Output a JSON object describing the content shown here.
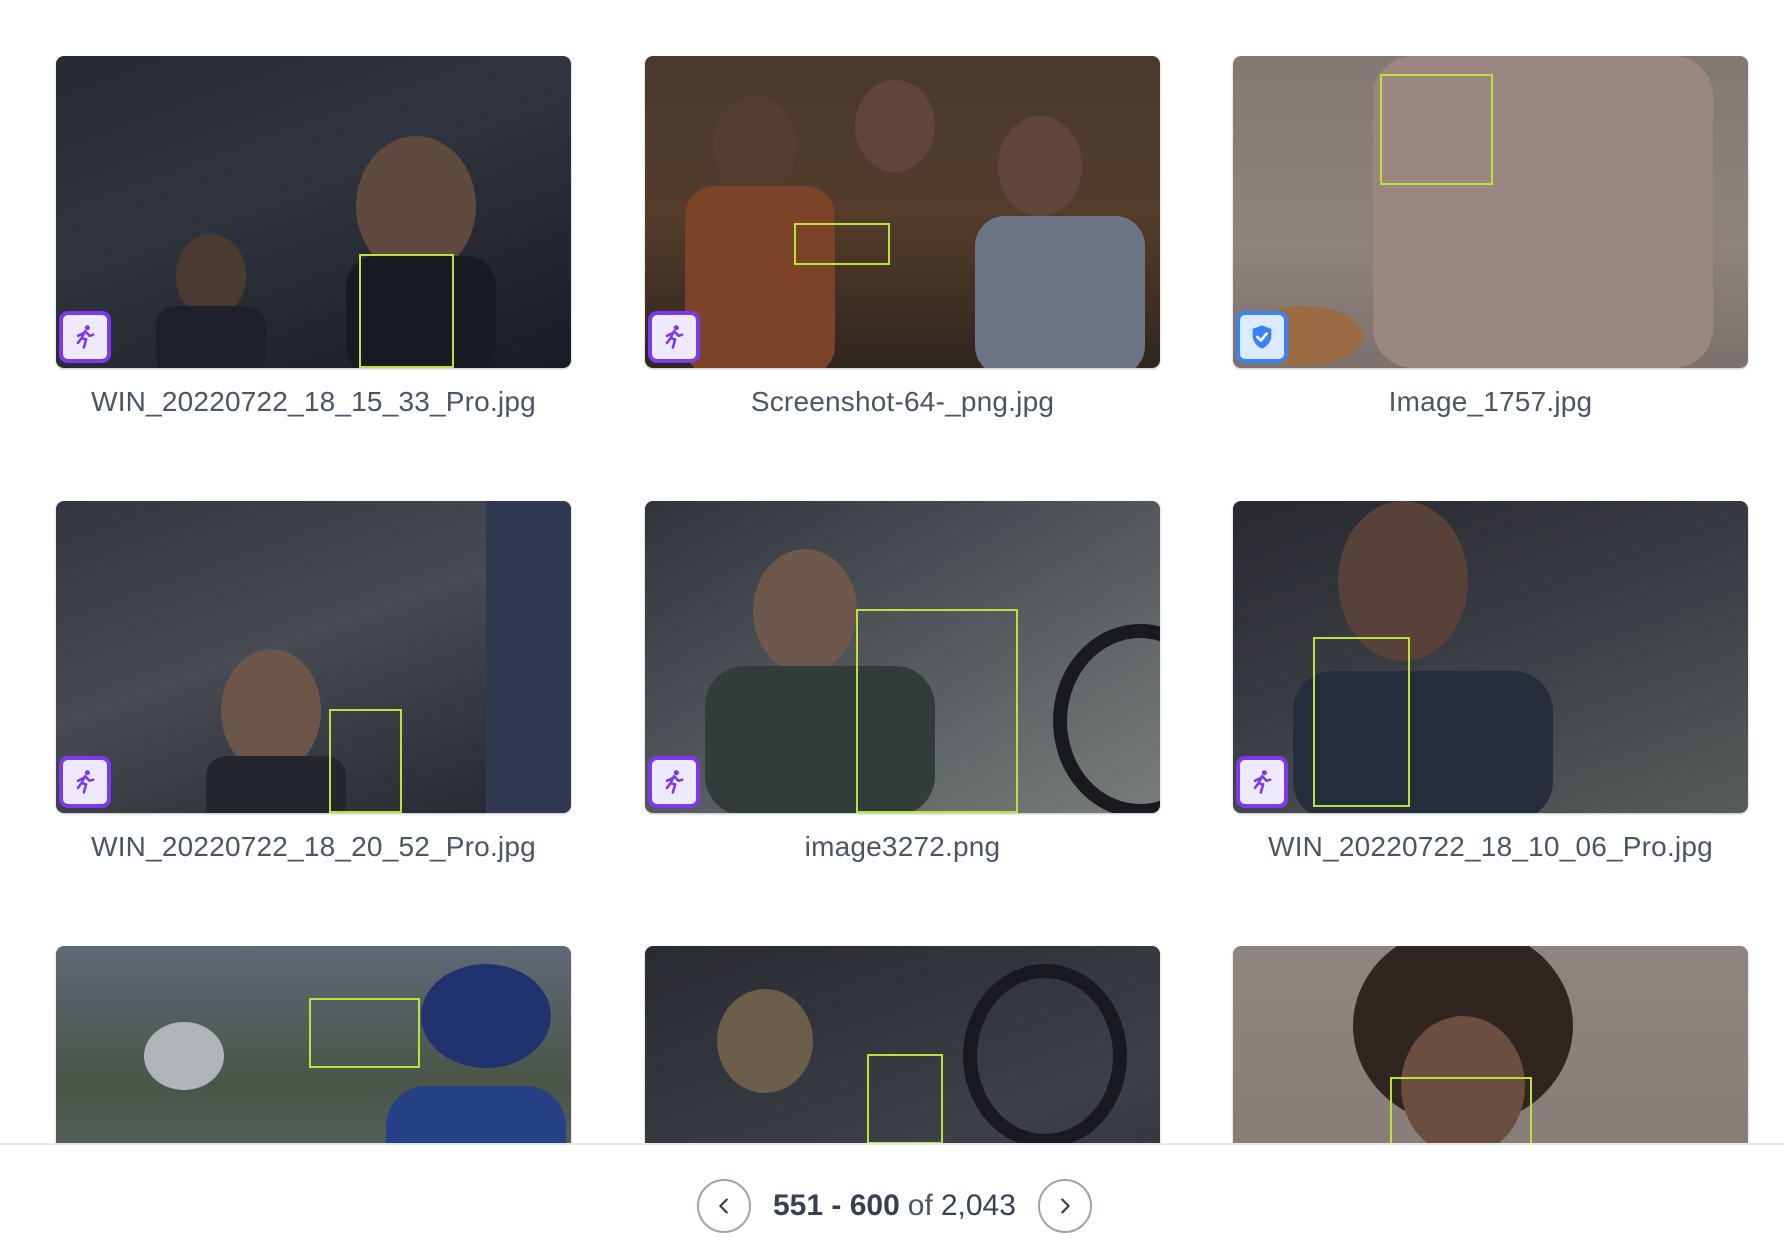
{
  "gallery": {
    "items": [
      {
        "filename": "WIN_20220722_18_15_33_Pro.jpg",
        "badge_icon": "running-person-icon",
        "badge_color": "#7c3aed"
      },
      {
        "filename": "Screenshot-64-_png.jpg",
        "badge_icon": "running-person-icon",
        "badge_color": "#7c3aed"
      },
      {
        "filename": "Image_1757.jpg",
        "badge_icon": "shield-check-icon",
        "badge_color": "#3b82f6"
      },
      {
        "filename": "WIN_20220722_18_20_52_Pro.jpg",
        "badge_icon": "running-person-icon",
        "badge_color": "#7c3aed"
      },
      {
        "filename": "image3272.png",
        "badge_icon": "running-person-icon",
        "badge_color": "#7c3aed"
      },
      {
        "filename": "WIN_20220722_18_10_06_Pro.jpg",
        "badge_icon": "running-person-icon",
        "badge_color": "#7c3aed"
      },
      {
        "filename": ""
      },
      {
        "filename": ""
      },
      {
        "filename": ""
      }
    ]
  },
  "pagination": {
    "range_start": "551",
    "range_sep": " - ",
    "range_end": "600",
    "of_label": "of",
    "total": "2,043",
    "prev_icon": "chevron-left-icon",
    "next_icon": "chevron-right-icon"
  },
  "colors": {
    "detection_box": "#b9e23c",
    "action_badge": "#7c3aed",
    "safe_badge": "#3b82f6"
  }
}
